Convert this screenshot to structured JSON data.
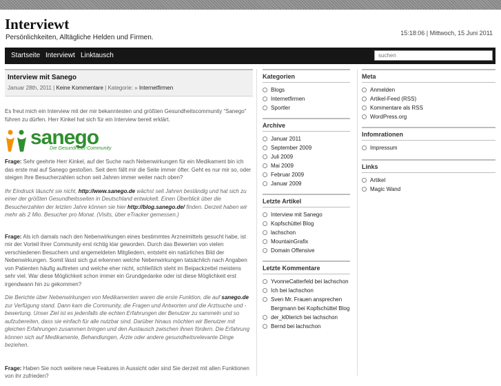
{
  "site": {
    "title": "Interviewt",
    "description": "Persönlichkeiten, Alltägliche Helden und Firmen.",
    "datetime": "15:18:06 | Mittwoch, 15 Juni 2011"
  },
  "nav": {
    "items": [
      "Startseite",
      "Interviewt",
      "Linktausch"
    ]
  },
  "search": {
    "placeholder": "suchen"
  },
  "post": {
    "title": "Interview mit Sanego",
    "date": "Januar 28th, 2011",
    "comments": "Keine Kommentare",
    "category_label": "Kategorie: »",
    "category": "Internetfirmen",
    "intro": "Es freut mich ein Interview mit der mir bekanntesten und größten Gesundheitscommunity “Sanego” führen zu dürfen. Herr Kinkel hat sich für ein Interview bereit erklärt.",
    "logo_word": "sanego",
    "logo_sub": "Die Gesundheits-Community",
    "q1_label": "Frage:",
    "q1": " Sehr geehrte Herr Kinkel, auf der Suche nach Nebenwirkungen für ein Medikament bin ich das erste mal auf Sanego gestoßen. Seit dem fällt mir die Seite immer öfter. Geht es nur mir so, oder steigen Ihre Besucherzahlen schon seit Jahren immer weiter nach oben?",
    "a1_pre": "Ihr Eindruck täuscht sie nicht, ",
    "a1_link1": "http://www.sanego.de",
    "a1_mid": " wächst seit Jahren beständig und hat sich zu einer der größten Gesundheitsseiten in Deutschland entwickelt. Einen Überblick über die Besucherzahlen der letzten Jahre können sie hier ",
    "a1_link2": "http://blog.sanego.de/",
    "a1_post": " finden. Derzeit haben wir mehr als 2 Mio. Besucher pro Monat. (Visits, über eTracker gemessen.)",
    "q2_label": "Frage:",
    "q2": " Als ich damals nach den Nebenwirkungen eines bestimmtes Arzneimittels gesucht habe, ist mir der Vorteil Ihrer Community erst richtig klar geworden. Durch das Bewerten von vielen verschiedenen Besuchern und angemeldeten Mitgliedern, entsteht ein natürliches Bild der Nebenwirkungen. Somit lässt sich gut erkennen welche Nebenwirkungen tatsächlich nach Angaben von Patienten häufig auftreten und welche eher nicht, schließlich steht im Beipackzettel meistens sehr viel. War diese Möglichkeit schon immer ein Grundgedanke oder ist diese Möglichkeit erst irgendwann hin zu gekommen?",
    "a2_pre": "Die Berichte über Nebenwirkungen von Medikamenten waren die erste Funktion, die auf ",
    "a2_link": "sanego.de",
    "a2_post": " zur Verfügung stand. Dann kam die Community, die Fragen und Antworten und die Arztsuche und -bewertung. Unser Ziel ist es jedenfalls die echten Erfahrungen der Benutzer zu sammeln und so aufzubereiten, dass sie einfach für alle nutzbar sind. Darüber hinaus möchten wir Benutzer mit gleichen Erfahrungen zusammen bringen und den Austausch zwischen ihnen fördern. Die Erfahrung können sich auf Medikamente, Behandlungen, Ärzte oder andere gesundheitsrelevante Dinge beziehen.",
    "q3_label": "Frage:",
    "q3": " Haben Sie noch weitere neue Features in Aussicht oder sind Sie derzeit mit allen Funktionen von ihr zufrieden?"
  },
  "sidebar_mid": {
    "categories_title": "Kategorien",
    "categories": [
      "Blogs",
      "Internetfirmen",
      "Sportler"
    ],
    "archive_title": "Archive",
    "archive": [
      "Januar 2011",
      "September 2009",
      "Juli 2009",
      "Mai 2009",
      "Februar 2009",
      "Januar 2009"
    ],
    "recent_title": "Letzte Artikel",
    "recent": [
      "Interview mit Sanego",
      "Kopfschüttel Blog",
      "lachschon",
      "MountainGrafix",
      "Domain Offensive"
    ],
    "comments_title": "Letzte Kommentare",
    "comments": [
      {
        "author": "YvonneCatterfeld",
        "on": " bei ",
        "post": "lachschon"
      },
      {
        "author": "Ich",
        "on": " bei ",
        "post": "lachschon"
      },
      {
        "author": "Sven Mr. Frauen ansprechen Bergmann",
        "on": " bei ",
        "post": "Kopfschüttel Blog"
      },
      {
        "author": "der_kl0terich",
        "on": " bei ",
        "post": "lachschon"
      },
      {
        "author": "Bernd",
        "on": " bei ",
        "post": "lachschon"
      }
    ]
  },
  "sidebar_right": {
    "meta_title": "Meta",
    "meta": [
      "Anmelden",
      "Artikel-Feed (RSS)",
      "Kommentare als RSS",
      "WordPress.org"
    ],
    "info_title": "Infomrationen",
    "info": [
      "Impressum"
    ],
    "links_title": "Links",
    "links": [
      "Artikel",
      "Magic Wand"
    ]
  },
  "colors": {
    "nav_bg": "#161616",
    "logo_green": "#2f8f2f"
  }
}
